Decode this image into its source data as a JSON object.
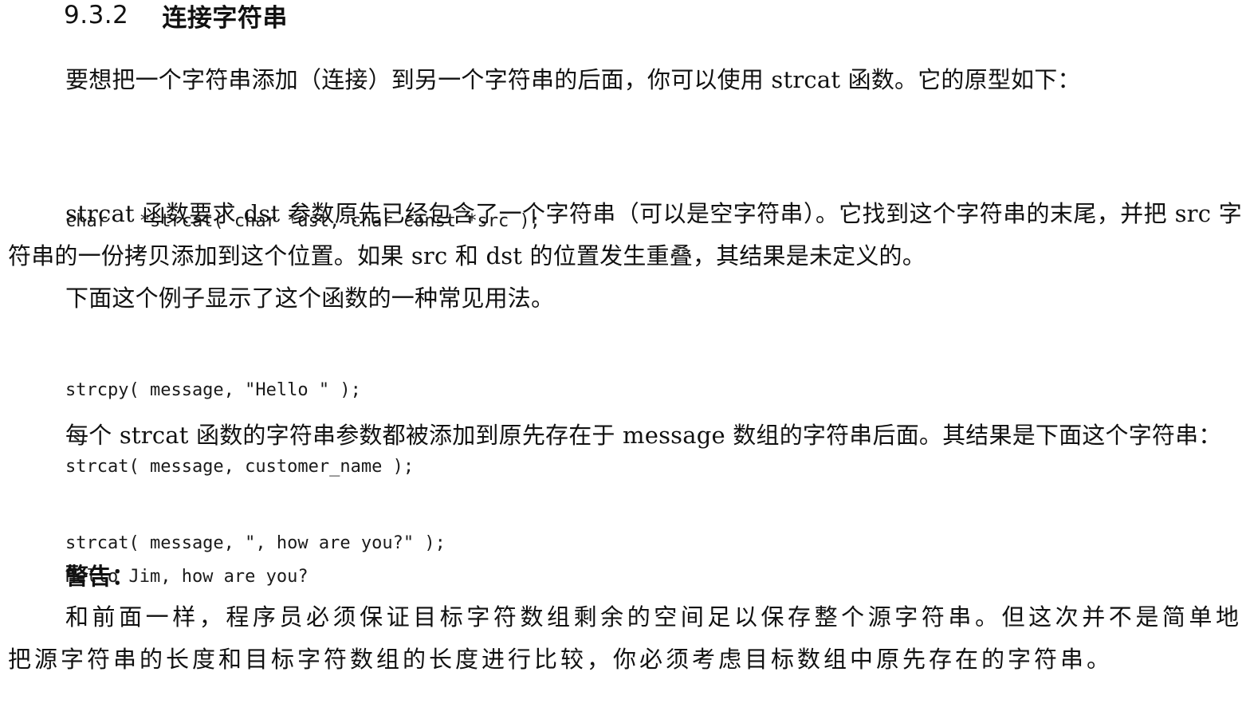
{
  "section": {
    "number": "9.3.2",
    "title": "连接字符串"
  },
  "paragraphs": {
    "intro": "要想把一个字符串添加（连接）到另一个字符串的后面，你可以使用 strcat 函数。它的原型如下：",
    "description": "strcat 函数要求 dst 参数原先已经包含了一个字符串（可以是空字符串）。它找到这个字符串的末尾，并把 src 字符串的一份拷贝添加到这个位置。如果 src 和 dst 的位置发生重叠，其结果是未定义的。",
    "example_intro": "下面这个例子显示了这个函数的一种常见用法。",
    "result_intro": "每个 strcat 函数的字符串参数都被添加到原先存在于 message 数组的字符串后面。其结果是下面这个字符串："
  },
  "code": {
    "prototype": "char   *strcat( char *dst, char const *src );",
    "example_lines": [
      "strcpy( message, \"Hello \" );",
      "strcat( message, customer_name );",
      "strcat( message, \", how are you?\" );"
    ],
    "result": "Hello Jim, how are you?"
  },
  "warning": {
    "title": "警告：",
    "body": "和前面一样，程序员必须保证目标字符数组剩余的空间足以保存整个源字符串。但这次并不是简单地把源字符串的长度和目标字符数组的长度进行比较，你必须考虑目标数组中原先存在的字符串。"
  }
}
